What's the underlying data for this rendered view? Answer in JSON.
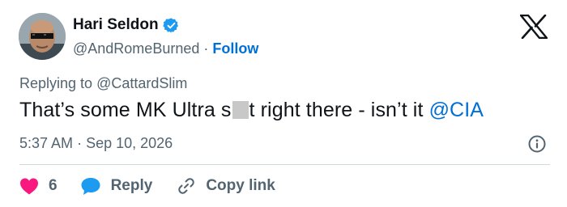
{
  "author": {
    "name": "Hari Seldon",
    "handle": "@AndRomeBurned",
    "separator": "·",
    "follow_label": "Follow"
  },
  "reply_context": {
    "prefix": "Replying to",
    "handle": "@CattardSlim"
  },
  "tweet": {
    "text_before": "That’s some MK Ultra s",
    "text_after": "t right there - isn’t it ",
    "mention": "@CIA"
  },
  "meta": {
    "time": "5:37 AM",
    "separator": "·",
    "date": "Sep 10, 2026"
  },
  "actions": {
    "like_count": "6",
    "reply_label": "Reply",
    "copy_label": "Copy link"
  },
  "colors": {
    "like": "#f91880",
    "reply": "#1d9bf0",
    "link": "#006fd6",
    "verified": "#1d9bf0"
  },
  "icons": {
    "verified": "verified-badge-icon",
    "platform": "x-logo-icon",
    "info": "info-icon",
    "like": "heart-icon",
    "reply": "speech-bubble-icon",
    "copy": "link-icon"
  }
}
